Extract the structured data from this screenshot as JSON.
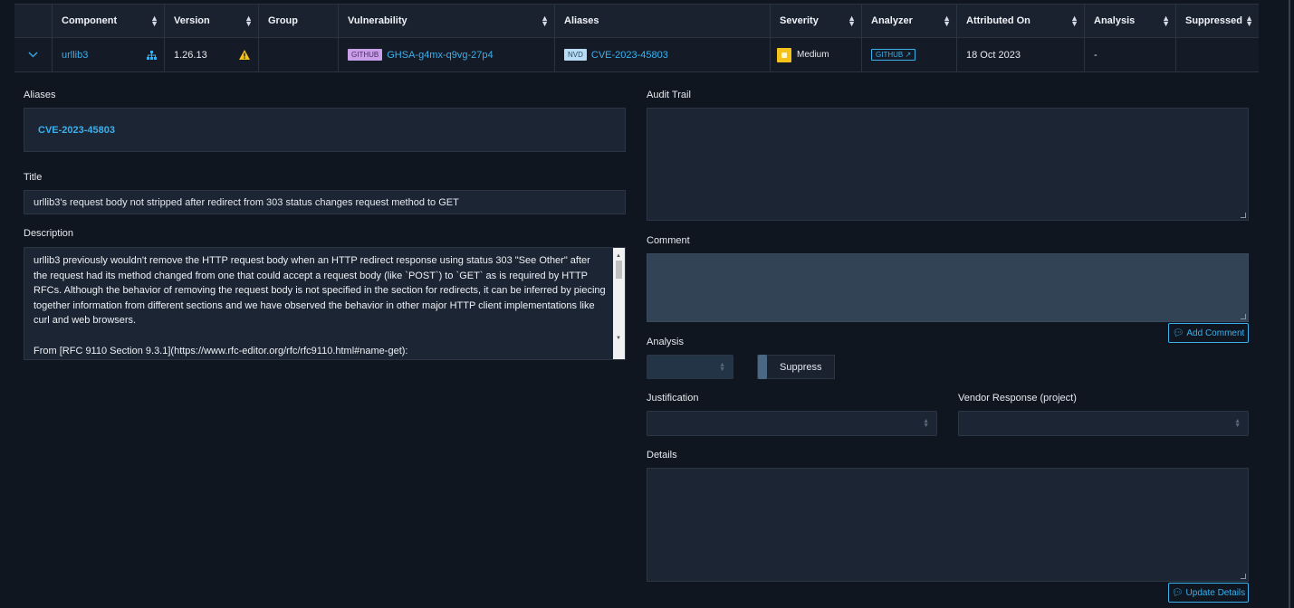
{
  "table": {
    "headers": [
      "",
      "Component",
      "Version",
      "Group",
      "Vulnerability",
      "Aliases",
      "Severity",
      "Analyzer",
      "Attributed On",
      "Analysis",
      "Suppressed"
    ],
    "row": {
      "component": "urllib3",
      "version": "1.26.13",
      "group": "",
      "vuln_source": "GITHUB",
      "vuln_id": "GHSA-g4mx-q9vg-27p4",
      "alias_source": "NVD",
      "alias_id": "CVE-2023-45803",
      "severity": "Medium",
      "analyzer": "GITHUB",
      "attributed_on": "18 Oct 2023",
      "analysis": "-",
      "suppressed": ""
    }
  },
  "detail": {
    "aliases_label": "Aliases",
    "aliases_value": "CVE-2023-45803",
    "title_label": "Title",
    "title_value": "urllib3's request body not stripped after redirect from 303 status changes request method to GET",
    "description_label": "Description",
    "description_p1": "urllib3 previously wouldn't remove the HTTP request body when an HTTP redirect response using status 303 \"See Other\" after the request had its method changed from one that could accept a request body (like `POST`) to `GET` as is required by HTTP RFCs. Although the behavior of removing the request body is not specified in the section for redirects, it can be inferred by piecing together information from different sections and we have observed the behavior in other major HTTP client implementations like curl and web browsers.",
    "description_p2": "From [RFC 9110 Section 9.3.1](https://www.rfc-editor.org/rfc/rfc9110.html#name-get):",
    "audit_trail_label": "Audit Trail",
    "comment_label": "Comment",
    "add_comment_label": "Add Comment",
    "analysis_label": "Analysis",
    "suppress_label": "Suppress",
    "justification_label": "Justification",
    "vendor_response_label": "Vendor Response (project)",
    "details_label": "Details",
    "update_details_label": "Update Details"
  },
  "colors": {
    "accent": "#3ab0ee",
    "severity_medium": "#f4c21b",
    "background": "#0f1620"
  }
}
